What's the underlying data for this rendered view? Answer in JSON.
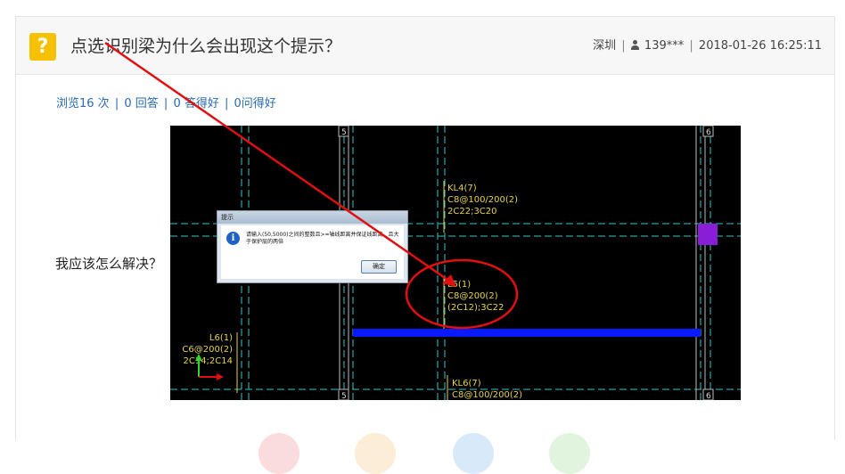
{
  "question": {
    "title": "点选识别梁为什么会出现这个提示？",
    "icon": "question-icon",
    "icon_glyph": "?",
    "location": "深圳",
    "user": "139***",
    "datetime": "2018-01-26 16:25:11",
    "stats": {
      "views": "浏览16 次",
      "answers": "0 回答",
      "good_answers": "0 答得好",
      "good_questions": "0问得好"
    },
    "body_text": "我应该怎么解决？"
  },
  "cad": {
    "axis_labels": [
      "5",
      "6",
      "5",
      "6"
    ],
    "kl4": [
      "KL4(7)",
      "C8@100/200(2)",
      "2C22;3C20"
    ],
    "l5": [
      "L5(1)",
      "C8@200(2)",
      "(2C12);3C22"
    ],
    "l6": [
      "L6(1)",
      "C6@200(2)",
      "2C14;2C14"
    ],
    "kl6": [
      "KL6(7)",
      "C8@100/200(2)"
    ],
    "dialog": {
      "title": "提示",
      "message": "请输入(50,5000)之间的整数且>=轴线距离并保证线距离，且大于保护层的两倍",
      "ok_label": "确定"
    }
  },
  "colors": {
    "accent_yellow": "#f6c200",
    "link_blue": "#2a6bb0",
    "annotation_red": "#e01010",
    "beam_blue": "#0a1aff",
    "cad_text": "#e6d24a",
    "column_purple": "#8a1ed8"
  }
}
